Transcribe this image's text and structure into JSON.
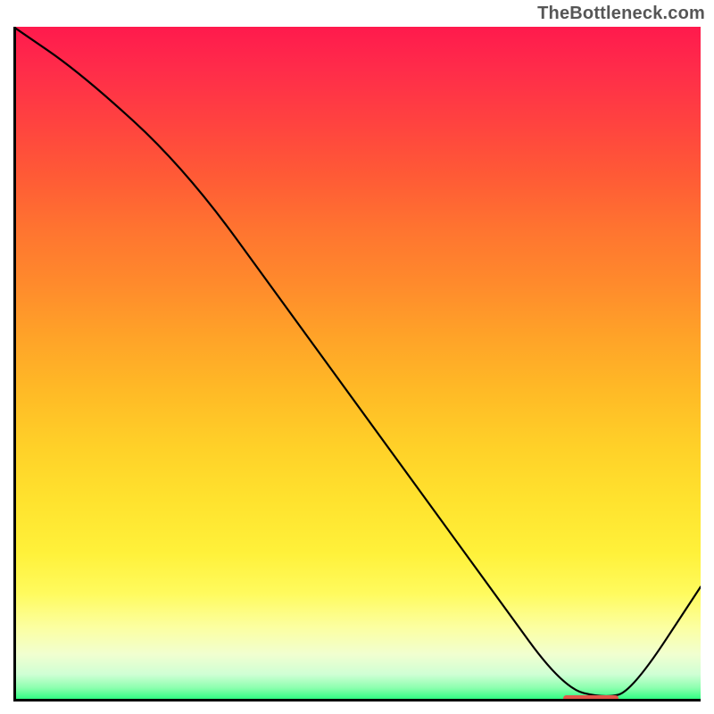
{
  "watermark": "TheBottleneck.com",
  "colors": {
    "curve": "#000000",
    "marker": "#e1574a",
    "axis": "#000000"
  },
  "chart_data": {
    "type": "line",
    "title": "",
    "xlabel": "",
    "ylabel": "",
    "xlim": [
      0,
      100
    ],
    "ylim": [
      0,
      100
    ],
    "x": [
      0,
      10,
      25,
      40,
      55,
      70,
      80,
      86,
      90,
      100
    ],
    "y": [
      100,
      93,
      79,
      58,
      37,
      16,
      2,
      0.5,
      1.5,
      17
    ],
    "optimal_region": {
      "x_start": 80,
      "x_end": 88,
      "y": 0.5
    },
    "gradient_note": "background maps y=100→red through orange/yellow to y=0→green"
  }
}
